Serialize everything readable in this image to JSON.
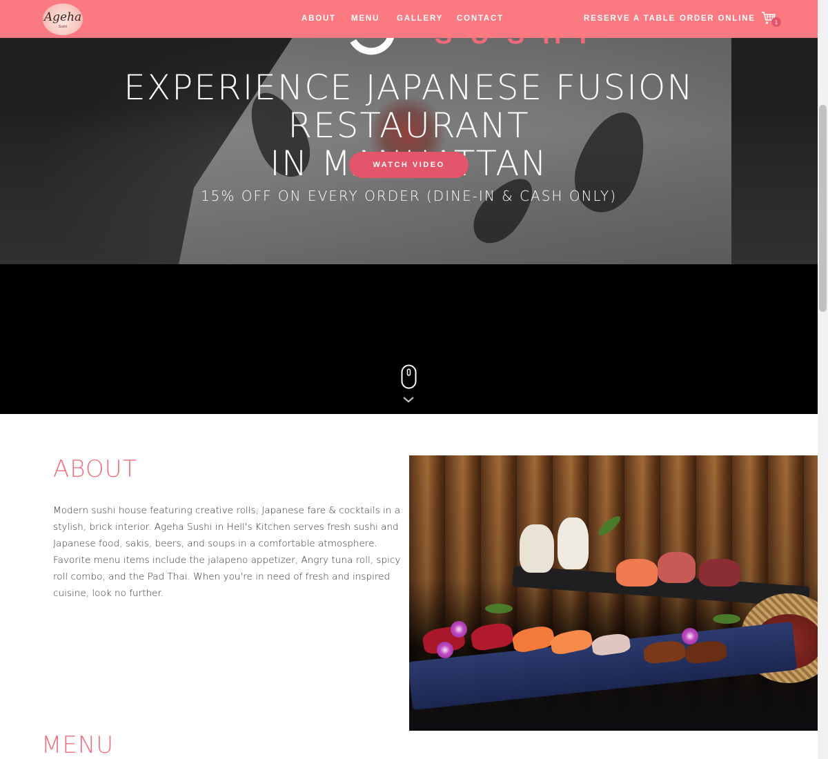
{
  "nav": {
    "logo_text": "Ageha",
    "logo_sub": "Sushi",
    "links": [
      {
        "label": "ABOUT"
      },
      {
        "label": "MENU"
      },
      {
        "label": "GALLERY"
      },
      {
        "label": "CONTACT"
      }
    ],
    "reserve_label": "RESERVE A TABLE",
    "order_label": "ORDER ONLINE",
    "cart_count": "1",
    "cart_icon": "shopping-cart-icon"
  },
  "hero": {
    "logo_word": "SUSHI",
    "title_line1": "EXPERIENCE JAPANESE FUSION RESTAURANT",
    "title_line2": "IN MANHATTAN",
    "watch_label": "WATCH VIDEO",
    "promo": "15% OFF ON EVERY ORDER (DINE-IN & CASH ONLY)"
  },
  "video": {
    "scroll_icon": "mouse-scroll-icon",
    "chevron_icon": "chevron-down-icon"
  },
  "about": {
    "title": "ABOUT",
    "text": "Modern sushi house featuring creative rolls, Japanese fare & cocktails in a stylish, brick interior. Ageha Sushi in Hell's Kitchen serves fresh sushi and Japanese food, sakis, beers, and soups in a comfortable atmosphere. Favorite menu items include the jalapeno appetizer, Angry tuna roll, spicy roll combo, and the Pad Thai. When you're in need of fresh and inspired cuisine, look no further."
  },
  "menu": {
    "title": "MENU"
  },
  "colors": {
    "nav_bg": "#fb7a81",
    "accent": "#e2556a",
    "heading": "#f0707d"
  }
}
